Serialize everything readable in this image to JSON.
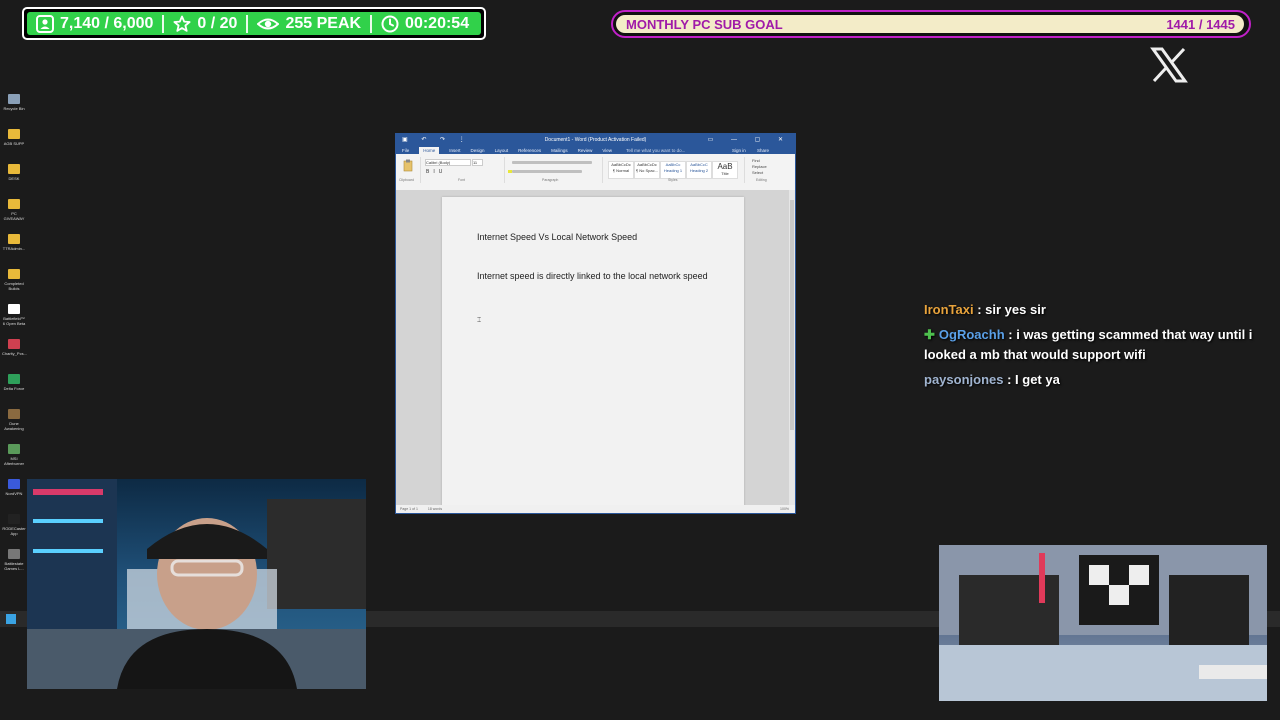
{
  "stats": {
    "followers": "7,140 / 6,000",
    "stars": "0 / 20",
    "viewers": "255 PEAK",
    "uptime": "00:20:54",
    "accent": "#31d14a"
  },
  "goal": {
    "title": "MONTHLY PC SUB GOAL",
    "count": "1441 / 1445",
    "progress": 0.997,
    "accent": "#a01aa8"
  },
  "desktop_icons": [
    {
      "label": "Recycle Bin",
      "color": "#8aa0b8"
    },
    {
      "label": "AGB SUPP",
      "color": "#e8b93a"
    },
    {
      "label": "DESK",
      "color": "#e8b93a"
    },
    {
      "label": "PC GIVEAWAY",
      "color": "#e8b93a"
    },
    {
      "label": "TTRAdmin...",
      "color": "#e8b93a"
    },
    {
      "label": "Completed Builds",
      "color": "#e8b93a"
    },
    {
      "label": "Battlefield™ 6 Open Beta",
      "color": "#ffffff"
    },
    {
      "label": "Charity_Pcs...",
      "color": "#d04050"
    },
    {
      "label": "Delta Force",
      "color": "#2ea05a"
    },
    {
      "label": "Dune Awakening",
      "color": "#8a6a40"
    },
    {
      "label": "MSI Afterburner",
      "color": "#5a9a5a"
    },
    {
      "label": "NordVPN",
      "color": "#3a5adb"
    },
    {
      "label": "RODECaster App",
      "color": "#222222"
    },
    {
      "label": "Battlestate Games L...",
      "color": "#777777"
    }
  ],
  "word": {
    "window_title": "Document1 - Word (Product Activation Failed)",
    "tabs": [
      "File",
      "Home",
      "Insert",
      "Design",
      "Layout",
      "References",
      "Mailings",
      "Review",
      "View"
    ],
    "tell_me": "Tell me what you want to do...",
    "sign_in": "Sign in",
    "share": "Share",
    "font_name": "Calibri (Body)",
    "font_size": "11",
    "styles": [
      "AaBbCcDc",
      "AaBbCcDc",
      "AaBbCc",
      "AaBbCcC",
      "AaB"
    ],
    "style_names": [
      "¶ Normal",
      "¶ No Spac...",
      "Heading 1",
      "Heading 2",
      "Title"
    ],
    "groups": [
      "Clipboard",
      "Font",
      "Paragraph",
      "Styles",
      "Editing"
    ],
    "editing": [
      "Find",
      "Replace",
      "Select"
    ],
    "doc_title": "Internet Speed Vs Local Network Speed",
    "doc_para": "Internet speed is directly linked to the local network speed",
    "status_left": "Page 1 of 1",
    "status_words": "18 words",
    "zoom": "100%"
  },
  "chat": [
    {
      "user": "IronTaxi",
      "color": "#e8a33c",
      "text": "sir yes sir",
      "badge": false
    },
    {
      "user": "OgRoachh",
      "color": "#5aa0e8",
      "text": "i was getting scammed that way until i looked a mb that would support wifi",
      "badge": true
    },
    {
      "user": "paysonjones",
      "color": "#a0b4d0",
      "text": "I get ya",
      "badge": false
    }
  ]
}
